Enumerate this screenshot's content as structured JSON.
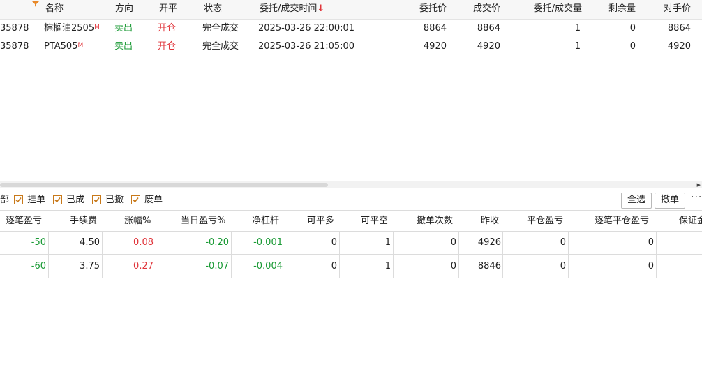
{
  "orders": {
    "columns": {
      "name": "名称",
      "direction": "方向",
      "openclose": "开平",
      "status": "状态",
      "time": "委托/成交时间",
      "time_sort": "↓",
      "order_price": "委托价",
      "fill_price": "成交价",
      "qty": "委托/成交量",
      "remaining": "剩余量",
      "counter_price": "对手价"
    },
    "rows": [
      {
        "id": "35878",
        "name": "棕榈油2505",
        "flag": "M",
        "direction": "卖出",
        "openclose": "开仓",
        "status": "完全成交",
        "time": "2025-03-26 22:00:01",
        "order_price": "8864",
        "fill_price": "8864",
        "qty": "1",
        "remaining": "0",
        "counter_price": "8864"
      },
      {
        "id": "35878",
        "name": "PTA505",
        "flag": "M",
        "direction": "卖出",
        "openclose": "开仓",
        "status": "完全成交",
        "time": "2025-03-26 21:05:00",
        "order_price": "4920",
        "fill_price": "4920",
        "qty": "1",
        "remaining": "0",
        "counter_price": "4920"
      }
    ]
  },
  "filters": {
    "all_partial": "部",
    "items": [
      {
        "label": "挂单",
        "checked": true
      },
      {
        "label": "已成",
        "checked": true
      },
      {
        "label": "已撤",
        "checked": true
      },
      {
        "label": "废单",
        "checked": true
      }
    ],
    "select_all": "全选",
    "cancel": "撤单",
    "more": "···"
  },
  "positions": {
    "columns": {
      "pnl": "逐笔盈亏",
      "fee": "手续费",
      "change": "涨幅%",
      "day_pnl": "当日盈亏%",
      "net_leverage": "净杠杆",
      "close_long": "可平多",
      "close_short": "可平空",
      "cancel_count": "撤单次数",
      "prev_close": "昨收",
      "close_pnl": "平仓盈亏",
      "trade_close_pnl": "逐笔平仓盈亏",
      "margin": "保证金"
    },
    "rows": [
      {
        "pnl": "-50",
        "fee": "4.50",
        "change": "0.08",
        "day_pnl": "-0.20",
        "net_leverage": "-0.001",
        "close_long": "0",
        "close_short": "1",
        "cancel_count": "0",
        "prev_close": "4926",
        "close_pnl": "0",
        "trade_close_pnl": "0"
      },
      {
        "pnl": "-60",
        "fee": "3.75",
        "change": "0.27",
        "day_pnl": "-0.07",
        "net_leverage": "-0.004",
        "close_long": "0",
        "close_short": "1",
        "cancel_count": "0",
        "prev_close": "8846",
        "close_pnl": "0",
        "trade_close_pnl": "0"
      }
    ]
  },
  "colors": {
    "sell": "#1a9a35",
    "open": "#e0343a",
    "accent": "#c8791a"
  }
}
